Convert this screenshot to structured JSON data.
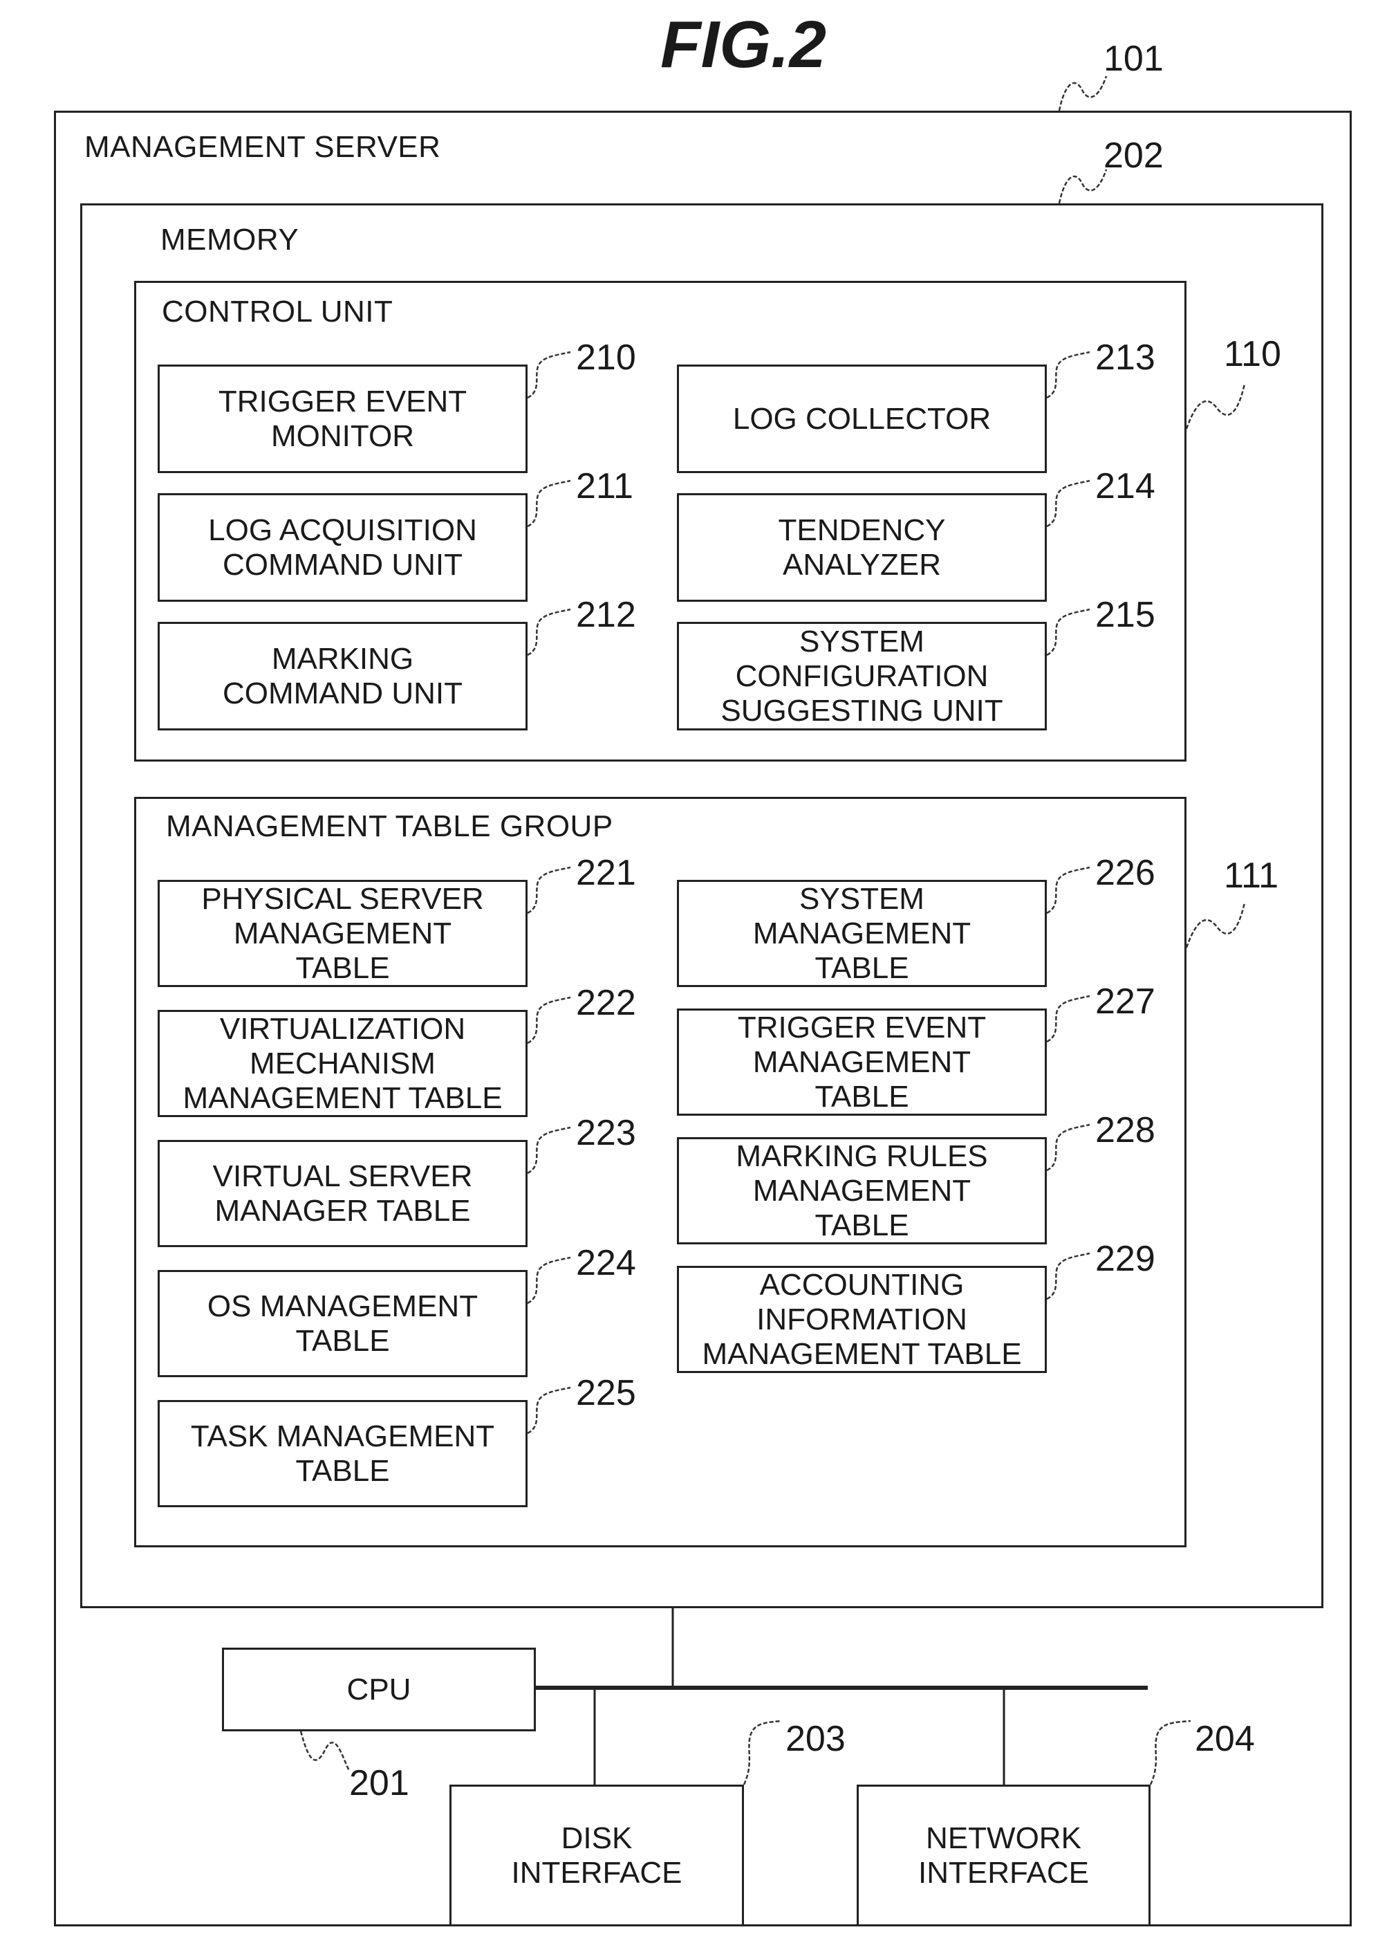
{
  "figure_title": "FIG.2",
  "management_server": {
    "label": "MANAGEMENT SERVER",
    "ref": "101"
  },
  "memory": {
    "label": "MEMORY",
    "ref": "202"
  },
  "control_unit": {
    "label": "CONTROL UNIT",
    "ref": "110",
    "left": [
      {
        "lines": [
          "TRIGGER EVENT",
          "MONITOR"
        ],
        "ref": "210"
      },
      {
        "lines": [
          "LOG ACQUISITION",
          "COMMAND UNIT"
        ],
        "ref": "211"
      },
      {
        "lines": [
          "MARKING",
          "COMMAND UNIT"
        ],
        "ref": "212"
      }
    ],
    "right": [
      {
        "lines": [
          "LOG COLLECTOR"
        ],
        "ref": "213"
      },
      {
        "lines": [
          "TENDENCY",
          "ANALYZER"
        ],
        "ref": "214"
      },
      {
        "lines": [
          "SYSTEM",
          "CONFIGURATION",
          "SUGGESTING UNIT"
        ],
        "ref": "215"
      }
    ]
  },
  "management_table_group": {
    "label": "MANAGEMENT TABLE GROUP",
    "ref": "111",
    "left": [
      {
        "lines": [
          "PHYSICAL SERVER",
          "MANAGEMENT",
          "TABLE"
        ],
        "ref": "221"
      },
      {
        "lines": [
          "VIRTUALIZATION",
          "MECHANISM",
          "MANAGEMENT TABLE"
        ],
        "ref": "222"
      },
      {
        "lines": [
          "VIRTUAL SERVER",
          "MANAGER TABLE"
        ],
        "ref": "223"
      },
      {
        "lines": [
          "OS MANAGEMENT",
          "TABLE"
        ],
        "ref": "224"
      },
      {
        "lines": [
          "TASK MANAGEMENT",
          "TABLE"
        ],
        "ref": "225"
      }
    ],
    "right": [
      {
        "lines": [
          "SYSTEM",
          "MANAGEMENT",
          "TABLE"
        ],
        "ref": "226"
      },
      {
        "lines": [
          "TRIGGER EVENT",
          "MANAGEMENT",
          "TABLE"
        ],
        "ref": "227"
      },
      {
        "lines": [
          "MARKING RULES",
          "MANAGEMENT",
          "TABLE"
        ],
        "ref": "228"
      },
      {
        "lines": [
          "ACCOUNTING",
          "INFORMATION",
          "MANAGEMENT TABLE"
        ],
        "ref": "229"
      }
    ]
  },
  "cpu": {
    "label": "CPU",
    "ref": "201"
  },
  "disk_interface": {
    "lines": [
      "DISK",
      "INTERFACE"
    ],
    "ref": "203"
  },
  "network_interface": {
    "lines": [
      "NETWORK",
      "INTERFACE"
    ],
    "ref": "204"
  }
}
